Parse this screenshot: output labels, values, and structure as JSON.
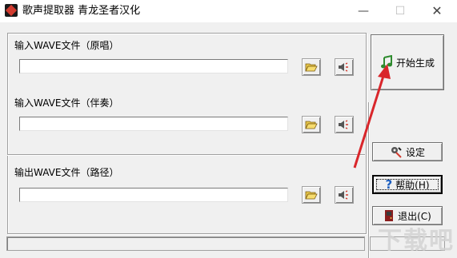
{
  "window": {
    "title": "歌声提取器 青龙圣者汉化",
    "min_glyph": "—",
    "max_glyph": "☐",
    "close_glyph": "✕"
  },
  "sections": {
    "original": {
      "label": "输入WAVE文件（原唱）",
      "value": ""
    },
    "accompaniment": {
      "label": "输入WAVE文件（伴奏）",
      "value": ""
    },
    "output": {
      "label": "输出WAVE文件（路径）",
      "value": ""
    }
  },
  "buttons": {
    "start": "开始生成",
    "settings": "设定",
    "help": "帮助(H)",
    "exit": "退出(C)"
  },
  "watermark": "下载吧",
  "colors": {
    "arrow": "#d9262b",
    "music_note": "#2e8b2e",
    "help_icon": "#1e5fbf",
    "exit_icon": "#8b1d1d"
  }
}
